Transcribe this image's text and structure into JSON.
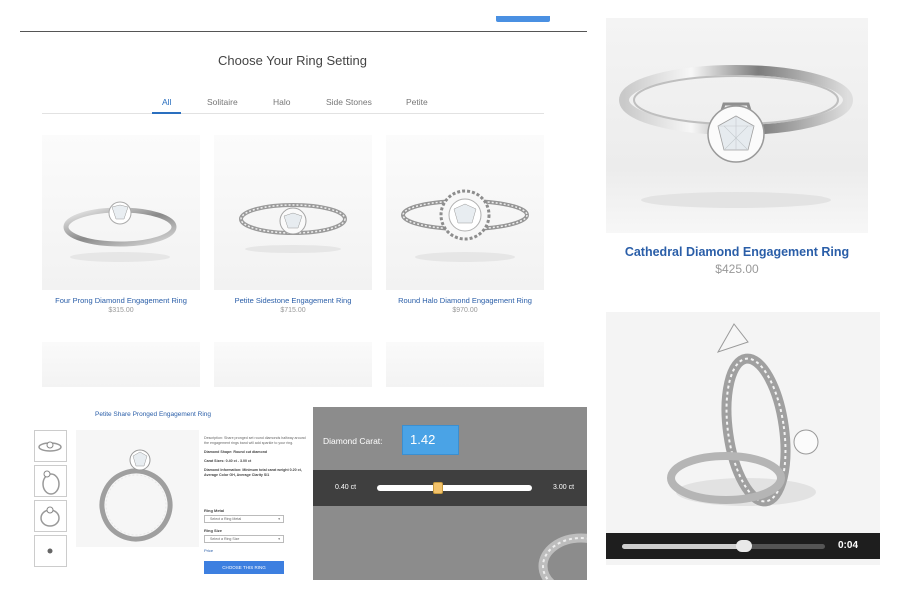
{
  "catalog": {
    "title": "Choose Your Ring Setting",
    "tabs": [
      {
        "label": "All",
        "active": true
      },
      {
        "label": "Solitaire",
        "active": false
      },
      {
        "label": "Halo",
        "active": false
      },
      {
        "label": "Side Stones",
        "active": false
      },
      {
        "label": "Petite",
        "active": false
      }
    ],
    "products": [
      {
        "name": "Four Prong Diamond Engagement Ring",
        "price": "$315.00"
      },
      {
        "name": "Petite Sidestone Engagement Ring",
        "price": "$715.00"
      },
      {
        "name": "Round Halo Diamond Engagement Ring",
        "price": "$970.00"
      }
    ],
    "accent_color": "#2a6fbf"
  },
  "featured": {
    "name": "Cathedral Diamond Engagement Ring",
    "price": "$425.00"
  },
  "detail": {
    "title": "Petite Share Pronged Engagement Ring",
    "description": "Description: Share pronged set round diamonds halfway around the engagement rings band will add sparkle to your ring.",
    "diamond_shape": "Diamond Shape: Round cut diamond",
    "carat_sizes": "Carat Sizes: 0.40 ct - 3.00 ct",
    "diamond_info": "Diamond Information: Minimum total carat weight 0.20 ct, Average Color GH, Average Clarity SI1",
    "metal_label": "Ring Metal",
    "metal_placeholder": "Select a Ring Metal",
    "size_label": "Ring Size",
    "size_placeholder": "Select a Ring Size",
    "price_link": "Price",
    "choose_button": "CHOOSE THIS RING",
    "button_color": "#3d7fe0"
  },
  "carat": {
    "label": "Diamond Carat:",
    "value": "1.42",
    "min_label": "0.40 ct",
    "max_label": "3.00 ct",
    "min": 0.4,
    "max": 3.0,
    "current": 1.42
  },
  "video": {
    "time": "0:04",
    "progress": 0.6
  }
}
